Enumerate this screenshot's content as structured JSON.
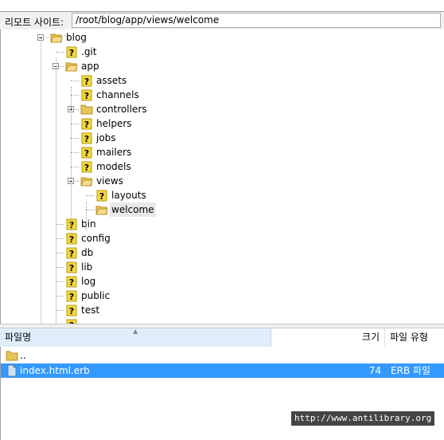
{
  "remote": {
    "label": "리모트 사이트:",
    "path": "/root/blog/app/views/welcome"
  },
  "tree": [
    {
      "name": "blog",
      "icon": "folder-open-icon",
      "expander": "minus"
    },
    {
      "name": ".git",
      "icon": "unknown-folder-icon"
    },
    {
      "name": "app",
      "icon": "folder-open-icon",
      "expander": "minus"
    },
    {
      "name": "assets",
      "icon": "unknown-folder-icon"
    },
    {
      "name": "channels",
      "icon": "unknown-folder-icon"
    },
    {
      "name": "controllers",
      "icon": "folder-icon",
      "expander": "plus"
    },
    {
      "name": "helpers",
      "icon": "unknown-folder-icon"
    },
    {
      "name": "jobs",
      "icon": "unknown-folder-icon"
    },
    {
      "name": "mailers",
      "icon": "unknown-folder-icon"
    },
    {
      "name": "models",
      "icon": "unknown-folder-icon"
    },
    {
      "name": "views",
      "icon": "folder-open-icon",
      "expander": "minus"
    },
    {
      "name": "layouts",
      "icon": "unknown-folder-icon"
    },
    {
      "name": "welcome",
      "icon": "folder-open-icon",
      "selected": true
    },
    {
      "name": "bin",
      "icon": "unknown-folder-icon"
    },
    {
      "name": "config",
      "icon": "unknown-folder-icon"
    },
    {
      "name": "db",
      "icon": "unknown-folder-icon"
    },
    {
      "name": "lib",
      "icon": "unknown-folder-icon"
    },
    {
      "name": "log",
      "icon": "unknown-folder-icon"
    },
    {
      "name": "public",
      "icon": "unknown-folder-icon"
    },
    {
      "name": "test",
      "icon": "unknown-folder-icon"
    },
    {
      "name": "",
      "icon": "unknown-folder-icon"
    }
  ],
  "list": {
    "columns": {
      "name": "파일명",
      "size": "크기",
      "type": "파일 유형"
    },
    "rows": [
      {
        "name": "..",
        "size": "",
        "type": "",
        "icon": "folder-icon"
      },
      {
        "name": "index.html.erb",
        "size": "74",
        "type": "ERB 파일",
        "icon": "file-icon",
        "selected": true
      }
    ]
  },
  "watermark": "http://www.antilibrary.org",
  "colors": {
    "selection": "#3399ff",
    "folder": "#e8c35a",
    "unknown_badge": "#f2d93a"
  }
}
